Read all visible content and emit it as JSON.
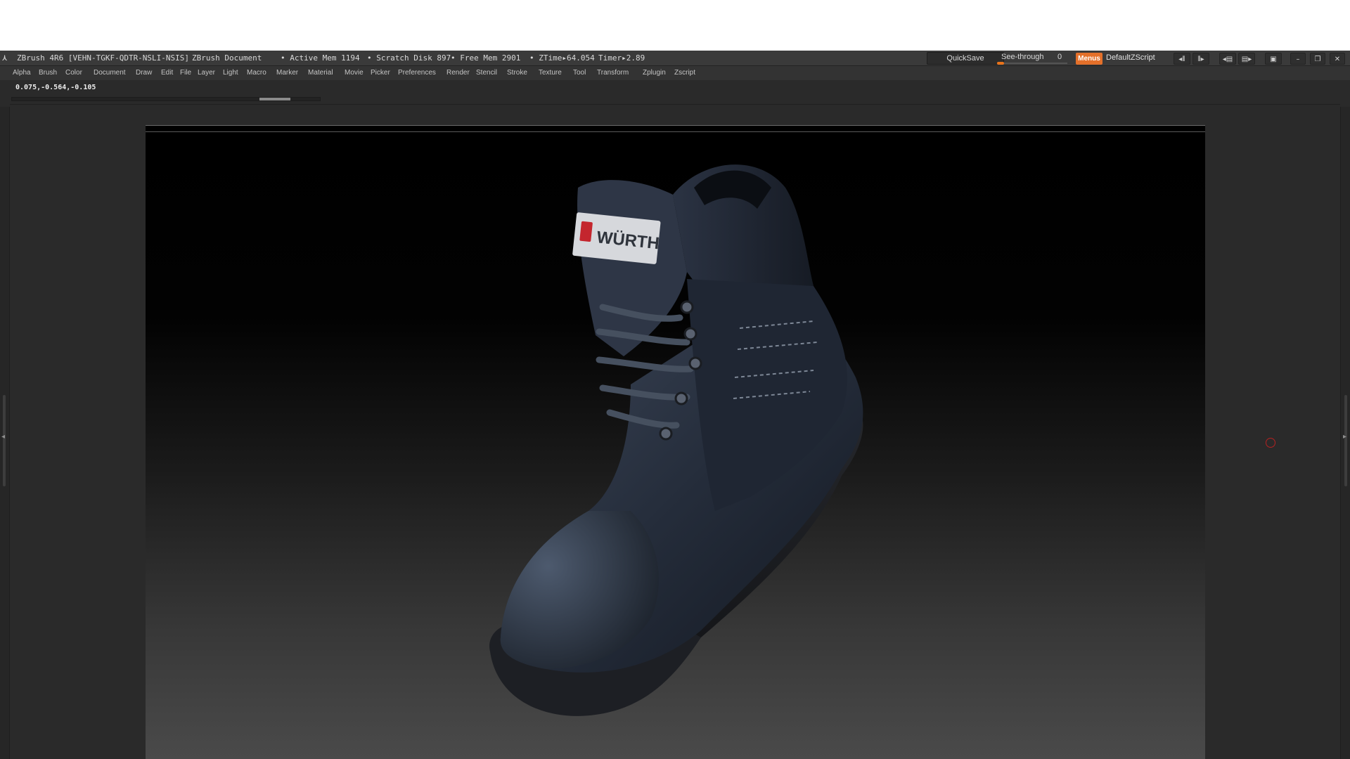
{
  "titlebar": {
    "app_title": "ZBrush 4R6 [VEHN-TGKF-QDTR-NSLI-NSIS]",
    "document": "ZBrush Document",
    "active_mem": "• Active Mem 1194",
    "scratch_disk": "• Scratch Disk 897",
    "free_mem": "• Free Mem 2901",
    "ztime": "• ZTime▸64.054",
    "timer": "Timer▸2.89",
    "quicksave": "QuickSave",
    "see_through_label": "See-through",
    "see_through_value": "0",
    "see_through_level": 0.1,
    "menus_button": "Menus",
    "default_script": "DefaultZScript",
    "accent_color": "#e4702a"
  },
  "menu": {
    "items": [
      "Alpha",
      "Brush",
      "Color",
      "Document",
      "Draw",
      "Edit",
      "File",
      "Layer",
      "Light",
      "Macro",
      "Marker",
      "Material",
      "Movie",
      "Picker",
      "Preferences",
      "Render",
      "Stencil",
      "Stroke",
      "Texture",
      "Tool",
      "Transform",
      "Zplugin",
      "Zscript"
    ]
  },
  "status": {
    "coords": "0.075,-0.564,-0.105"
  },
  "canvas": {
    "label_text": "WÜRTH",
    "brand_color": "#c4262e"
  }
}
